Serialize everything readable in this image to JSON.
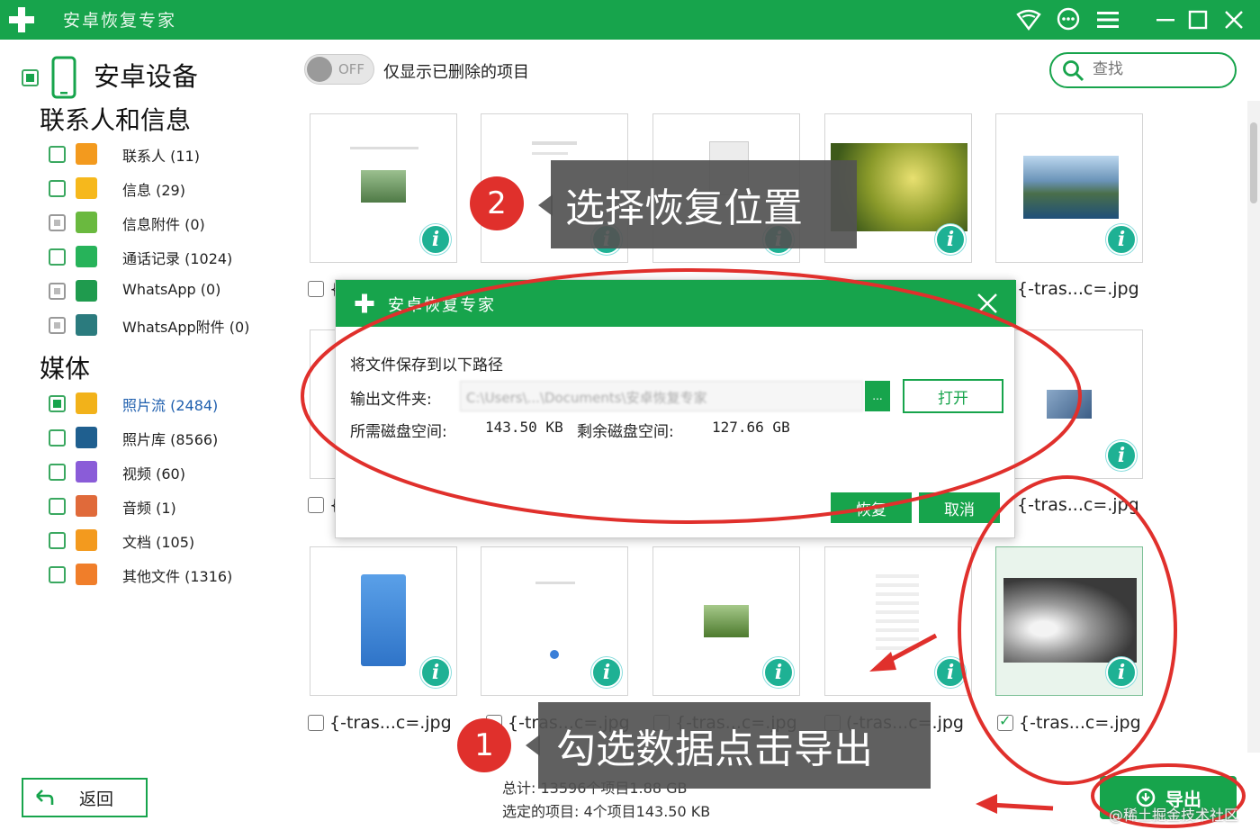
{
  "app": {
    "title": "安卓恢复专家",
    "accent": "#17a44c"
  },
  "sidebar": {
    "device_title": "安卓设备",
    "section_contacts": "联系人和信息",
    "section_media": "媒体",
    "contacts": [
      {
        "label": "联系人 (11)",
        "icon": "contacts-icon",
        "color": "#f39a1e"
      },
      {
        "label": "信息 (29)",
        "icon": "message-icon",
        "color": "#f6b81c"
      },
      {
        "label": "信息附件 (0)",
        "icon": "attachment-icon",
        "color": "#6ab93f"
      },
      {
        "label": "通话记录 (1024)",
        "icon": "phone-icon",
        "color": "#27b35a"
      },
      {
        "label": "WhatsApp (0)",
        "icon": "whatsapp-icon",
        "color": "#1f9b4e"
      },
      {
        "label": "WhatsApp附件 (0)",
        "icon": "whatsapp-attachment-icon",
        "color": "#2b7b7e"
      }
    ],
    "media": [
      {
        "label": "照片流 (2484)",
        "icon": "star-icon",
        "color": "#f2b21a"
      },
      {
        "label": "照片库 (8566)",
        "icon": "gallery-icon",
        "color": "#1f5f8f"
      },
      {
        "label": "视频 (60)",
        "icon": "video-icon",
        "color": "#8a5cd8"
      },
      {
        "label": "音频 (1)",
        "icon": "audio-icon",
        "color": "#e06a3a"
      },
      {
        "label": "文档 (105)",
        "icon": "document-icon",
        "color": "#f39a1e"
      },
      {
        "label": "其他文件 (1316)",
        "icon": "other-file-icon",
        "color": "#f07e2a"
      }
    ],
    "back_label": "返回"
  },
  "toolbar": {
    "toggle_state": "OFF",
    "toggle_label": "仅显示已删除的项目",
    "search_placeholder": "查找"
  },
  "grid": {
    "file_label": "{-tras...c=.jpg",
    "file_label_alt": "(-tras...c=.jpg",
    "row_labels": [
      "{",
      "{-tras...c=.jpg",
      "{",
      "{-tras...c=.jpg"
    ]
  },
  "dialog": {
    "title": "安卓恢复专家",
    "heading": "将文件保存到以下路径",
    "output_label": "输出文件夹:",
    "output_path": "C:\\Users\\...\\Documents\\安卓恢复专家",
    "browse": "...",
    "open_label": "打开",
    "required_label": "所需磁盘空间:",
    "required_value": "143.50 KB",
    "remaining_label": "剩余磁盘空间:",
    "remaining_value": "127.66 GB",
    "recover_label": "恢复",
    "cancel_label": "取消"
  },
  "status": {
    "total": "总计: 13596个项目1.88 GB",
    "selected": "选定的项目: 4个项目143.50 KB"
  },
  "export_label": "导出",
  "annotations": {
    "step1_number": "1",
    "step1_text": "勾选数据点击导出",
    "step2_number": "2",
    "step2_text": "选择恢复位置",
    "watermark": "@稀土掘金技术社区"
  }
}
